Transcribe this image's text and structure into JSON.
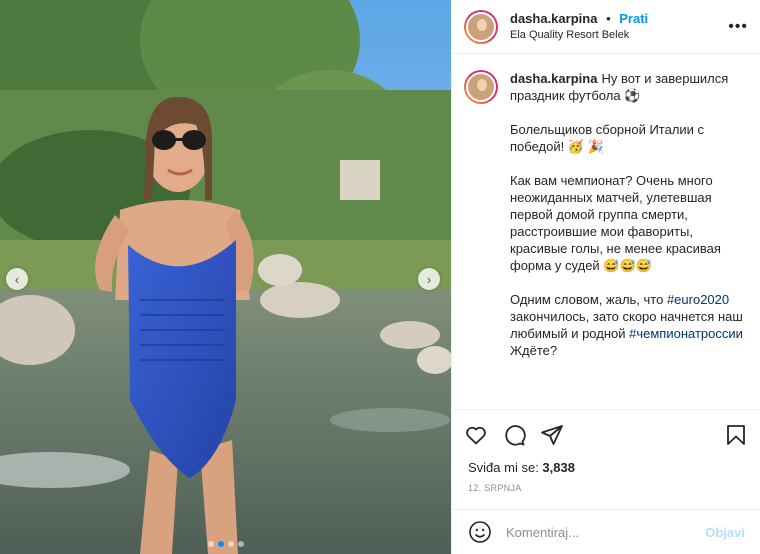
{
  "post": {
    "username": "dasha.karpina",
    "separator": "•",
    "follow_label": "Prati",
    "location": "Ela Quality Resort Belek",
    "more_label": "•••"
  },
  "photo": {
    "nav_prev": "‹",
    "nav_next": "›",
    "carousel_total": 4,
    "carousel_active": 1
  },
  "caption": {
    "username": "dasha.karpina",
    "p1": "Ну вот и завершился праздник футбола ⚽",
    "p2": "Болельщиков сборной Италии с победой! 🥳 🎉",
    "p3": "Как вам чемпионат? Очень много неожиданных матчей, улетевшая первой домой группа смерти, расстроившие мои фавориты, красивые голы, не менее красивая форма у судей 😅😅😅",
    "p4_a": "Одним словом, жаль, что ",
    "p4_tag1": "#euro2020",
    "p4_b": " закончилось, зато скоро начнется наш любимый и родной ",
    "p4_tag2": "#чемпионатроссии",
    "p4_c": "Ждёте?"
  },
  "actions": {
    "icons": [
      "heart-icon",
      "comment-icon",
      "share-icon",
      "bookmark-icon"
    ]
  },
  "likes": {
    "label": "Sviđa mi se: ",
    "count": "3,838"
  },
  "date": "12. SRPNJA",
  "comment_box": {
    "placeholder": "Komentiraj...",
    "post_label": "Objavi"
  },
  "colors": {
    "accent": "#0095f6",
    "hashtag": "#00376b",
    "swimsuit": "#2f53c4",
    "sky": "#6fb3e8"
  }
}
